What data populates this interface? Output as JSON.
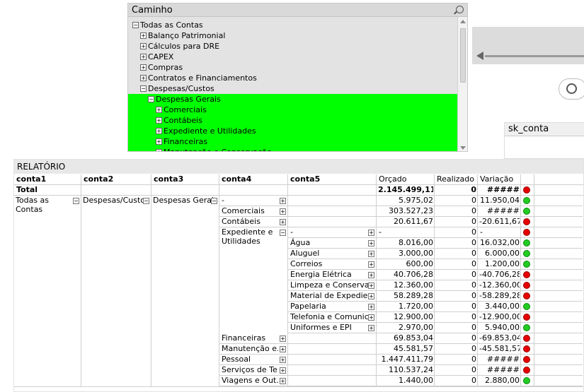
{
  "tree": {
    "title": "Caminho",
    "items": [
      {
        "label": "Todas as Contas",
        "toggle": "−",
        "level": 0,
        "selected": false
      },
      {
        "label": "Balanço Patrimonial",
        "toggle": "+",
        "level": 1,
        "selected": false
      },
      {
        "label": "Cálculos para DRE",
        "toggle": "+",
        "level": 1,
        "selected": false
      },
      {
        "label": "CAPEX",
        "toggle": "+",
        "level": 1,
        "selected": false
      },
      {
        "label": "Compras",
        "toggle": "+",
        "level": 1,
        "selected": false
      },
      {
        "label": "Contratos e Financiamentos",
        "toggle": "+",
        "level": 1,
        "selected": false
      },
      {
        "label": "Despesas/Custos",
        "toggle": "−",
        "level": 1,
        "selected": false
      },
      {
        "label": "Despesas Gerais",
        "toggle": "−",
        "level": 2,
        "selected": true
      },
      {
        "label": "Comerciais",
        "toggle": "+",
        "level": 3,
        "selected": true
      },
      {
        "label": "Contábeis",
        "toggle": "+",
        "level": 3,
        "selected": true
      },
      {
        "label": "Expediente e Utilidades",
        "toggle": "+",
        "level": 3,
        "selected": true
      },
      {
        "label": "Financeiras",
        "toggle": "+",
        "level": 3,
        "selected": true
      },
      {
        "label": "Manutenção e Conservação",
        "toggle": "+",
        "level": 3,
        "selected": true
      }
    ]
  },
  "sk": {
    "title": "sk_conta"
  },
  "report": {
    "title": "RELATÓRIO",
    "headers": [
      "conta1",
      "conta2",
      "conta3",
      "conta4",
      "conta5",
      "Orçado",
      "Realizado",
      "Variação"
    ],
    "total": {
      "label": "Total",
      "orcado": "2.145.499,11",
      "realizado": "0",
      "variacao": "#####",
      "status": "red"
    },
    "conta1": [
      "Todas as",
      "Contas"
    ],
    "conta2": "Despesas/Custos",
    "conta3": "Despesas Gerais",
    "expediente_label": [
      "Expediente e",
      "Utilidades"
    ],
    "rows": [
      {
        "c4": "-",
        "c5": "",
        "orcado": "5.975,02",
        "realizado": "0",
        "variacao": "11.950,04",
        "status": "green"
      },
      {
        "c4": "Comerciais",
        "c5": "",
        "orcado": "303.527,23",
        "realizado": "0",
        "variacao": "#####",
        "status": "green"
      },
      {
        "c4": "Contábeis",
        "c5": "",
        "orcado": "20.611,67",
        "realizado": "0",
        "variacao": "-20.611,67",
        "status": "red"
      },
      {
        "c4": "",
        "c5": "-",
        "orcado": "-",
        "realizado": "0",
        "variacao": "-",
        "status": "red"
      },
      {
        "c4": "",
        "c5": "Água",
        "orcado": "8.016,00",
        "realizado": "0",
        "variacao": "16.032,00",
        "status": "green"
      },
      {
        "c4": "",
        "c5": "Aluguel",
        "orcado": "3.000,00",
        "realizado": "0",
        "variacao": "6.000,00",
        "status": "green"
      },
      {
        "c4": "",
        "c5": "Correios",
        "orcado": "600,00",
        "realizado": "0",
        "variacao": "1.200,00",
        "status": "green"
      },
      {
        "c4": "",
        "c5": "Energia Elétrica",
        "orcado": "40.706,28",
        "realizado": "0",
        "variacao": "-40.706,28",
        "status": "red"
      },
      {
        "c4": "",
        "c5": "Limpeza e Conserva...",
        "orcado": "12.360,00",
        "realizado": "0",
        "variacao": "-12.360,00",
        "status": "red"
      },
      {
        "c4": "",
        "c5": "Material de Expedien...",
        "orcado": "58.289,28",
        "realizado": "0",
        "variacao": "-58.289,28",
        "status": "red"
      },
      {
        "c4": "",
        "c5": "Papelaria",
        "orcado": "1.720,00",
        "realizado": "0",
        "variacao": "3.440,00",
        "status": "green"
      },
      {
        "c4": "",
        "c5": "Telefonia e Comunic...",
        "orcado": "12.900,00",
        "realizado": "0",
        "variacao": "-12.900,00",
        "status": "red"
      },
      {
        "c4": "",
        "c5": "Uniformes e EPI",
        "orcado": "2.970,00",
        "realizado": "0",
        "variacao": "5.940,00",
        "status": "green"
      },
      {
        "c4": "Financeiras",
        "c5": "",
        "orcado": "69.853,04",
        "realizado": "0",
        "variacao": "-69.853,04",
        "status": "red"
      },
      {
        "c4": "Manutenção e...",
        "c5": "",
        "orcado": "45.581,57",
        "realizado": "0",
        "variacao": "-45.581,57",
        "status": "red"
      },
      {
        "c4": "Pessoal",
        "c5": "",
        "orcado": "1.447.411,79",
        "realizado": "0",
        "variacao": "#####",
        "status": "red"
      },
      {
        "c4": "Serviços de Te...",
        "c5": "",
        "orcado": "110.537,24",
        "realizado": "0",
        "variacao": "#####",
        "status": "red"
      },
      {
        "c4": "Viagens e Out...",
        "c5": "",
        "orcado": "1.440,00",
        "realizado": "0",
        "variacao": "2.880,00",
        "status": "green"
      }
    ]
  }
}
